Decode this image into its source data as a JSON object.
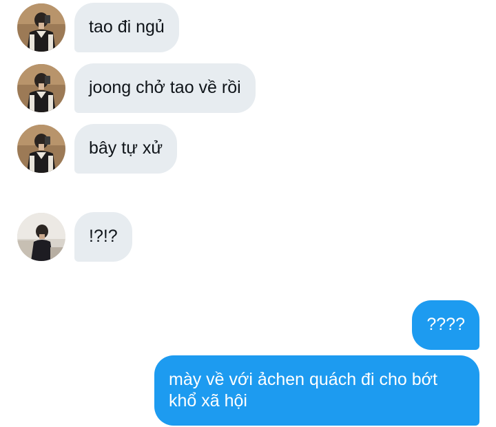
{
  "conversation": {
    "messages": [
      {
        "direction": "received",
        "text": "tao đi ngủ"
      },
      {
        "direction": "received",
        "text": "joong chở tao về rồi"
      },
      {
        "direction": "received",
        "text": "bây tự xử"
      },
      {
        "direction": "received",
        "text": "!?!?"
      },
      {
        "direction": "sent",
        "text": "????"
      },
      {
        "direction": "sent",
        "text": "mày về với ảchen quách đi cho bớt khổ xã hội"
      }
    ]
  },
  "colors": {
    "incoming_bubble": "#e7ecf0",
    "outgoing_bubble": "#1d9bf0",
    "incoming_text": "#0f1419",
    "outgoing_text": "#ffffff"
  },
  "icons": {
    "sender_1_avatar": "avatar-photo-mirror-selfie",
    "sender_2_avatar": "avatar-photo-seated-person"
  }
}
